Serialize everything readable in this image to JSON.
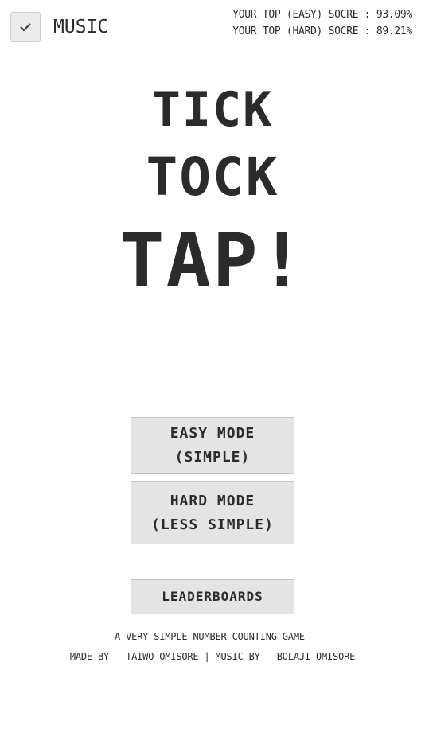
{
  "music": {
    "label": "MUSIC",
    "checked": true
  },
  "scores": {
    "easy": "YOUR TOP (EASY) SOCRE : 93.09%",
    "hard": "YOUR TOP (HARD) SOCRE : 89.21%"
  },
  "title": {
    "line1": "TICK",
    "line2": "TOCK",
    "line3": "TAP!"
  },
  "buttons": {
    "easy_line1": "EASY MODE",
    "easy_line2": "(SIMPLE)",
    "hard_line1": "HARD MODE",
    "hard_line2": "(LESS SIMPLE)",
    "leaderboards": "LEADERBOARDS"
  },
  "footer": {
    "tagline": "-A VERY SIMPLE NUMBER COUNTING GAME -",
    "credits": "MADE BY - TAIWO OMISORE  |  MUSIC BY - BOLAJI OMISORE"
  },
  "colors": {
    "text": "#2b2b2b",
    "button_bg": "#e4e4e4",
    "button_border": "#c2c2c2",
    "background": "#ffffff"
  }
}
